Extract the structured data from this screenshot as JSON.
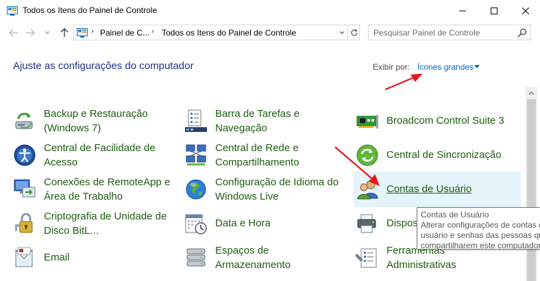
{
  "window": {
    "title": "Todos os Itens do Painel de Controle"
  },
  "address": {
    "crumbs": [
      "Painel de C...",
      "Todos os Itens do Painel de Controle"
    ],
    "search_placeholder": "Pesquisar Painel de Controle"
  },
  "content": {
    "heading": "Ajuste as configurações do computador",
    "view_by_label": "Exibir por:",
    "view_by_value": "Ícones grandes"
  },
  "items": {
    "backup": {
      "line1": "Backup e Restauração",
      "line2": "(Windows 7)",
      "icon": "backup-restore-icon"
    },
    "taskbar": {
      "line1": "Barra de Tarefas e",
      "line2": "Navegação",
      "icon": "taskbar-icon"
    },
    "broadcom": {
      "line1": "Broadcom Control Suite 3",
      "icon": "network-card-icon"
    },
    "ease": {
      "line1": "Central de Facilidade de",
      "line2": "Acesso",
      "icon": "ease-of-access-icon"
    },
    "network": {
      "line1": "Central de Rede e",
      "line2": "Compartilhamento",
      "icon": "network-center-icon"
    },
    "sync": {
      "line1": "Central de Sincronização",
      "icon": "sync-center-icon"
    },
    "remoteapp": {
      "line1": "Conexões de RemoteApp e",
      "line2": "Área de Trabalho",
      "icon": "remoteapp-icon"
    },
    "language": {
      "line1": "Configuração de Idioma do",
      "line2": "Windows Live",
      "icon": "globe-icon"
    },
    "users": {
      "line1": "Contas de Usuário",
      "icon": "user-accounts-icon"
    },
    "bitlocker": {
      "line1": "Criptografia de Unidade de",
      "line2": "Disco BitL...",
      "icon": "bitlocker-icon"
    },
    "datetime": {
      "line1": "Data e Hora",
      "icon": "calendar-clock-icon"
    },
    "devices": {
      "line1": "Dispos",
      "icon": "printer-icon"
    },
    "email": {
      "line1": "Email",
      "icon": "mail-icon"
    },
    "storage": {
      "line1": "Espaços de",
      "line2": "Armazenamento",
      "icon": "storage-spaces-icon"
    },
    "admin": {
      "line1": "Ferramentas",
      "line2": "Administrativas",
      "icon": "admin-tools-icon"
    }
  },
  "tooltip": {
    "title": "Contas de Usuário",
    "lines": [
      "Alterar configurações de contas de",
      "usuário e senhas das pessoas que",
      "compartilharem este computador."
    ]
  },
  "colors": {
    "heading": "#1e3287",
    "link": "#1e5b12",
    "accent": "#0066cc",
    "hover_bg": "#e5f3fb",
    "annotation_arrow": "#e8161a"
  }
}
